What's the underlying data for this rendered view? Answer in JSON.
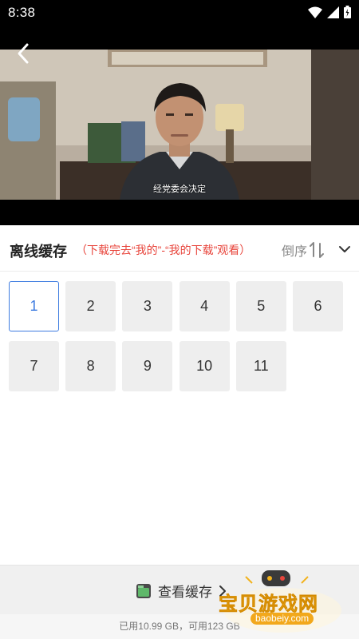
{
  "status_bar": {
    "time": "8:38"
  },
  "video": {
    "subtitle": "经党委会决定"
  },
  "header": {
    "title": "离线缓存",
    "hint": "（下载完去“我的”-“我的下载”观看）",
    "sort_label": "倒序"
  },
  "episodes": [
    {
      "label": "1",
      "selected": true
    },
    {
      "label": "2"
    },
    {
      "label": "3"
    },
    {
      "label": "4"
    },
    {
      "label": "5"
    },
    {
      "label": "6"
    },
    {
      "label": "7"
    },
    {
      "label": "8"
    },
    {
      "label": "9"
    },
    {
      "label": "10"
    },
    {
      "label": "11"
    }
  ],
  "bottom": {
    "view_cache_label": "查看缓存",
    "storage_text": "已用10.99 GB，可用123 GB"
  },
  "watermark": {
    "text": "宝贝游戏网",
    "url": "baobeiy.com"
  },
  "colors": {
    "accent": "#3d7be0",
    "hint": "#e8453c",
    "watermark": "#f2b21c"
  }
}
